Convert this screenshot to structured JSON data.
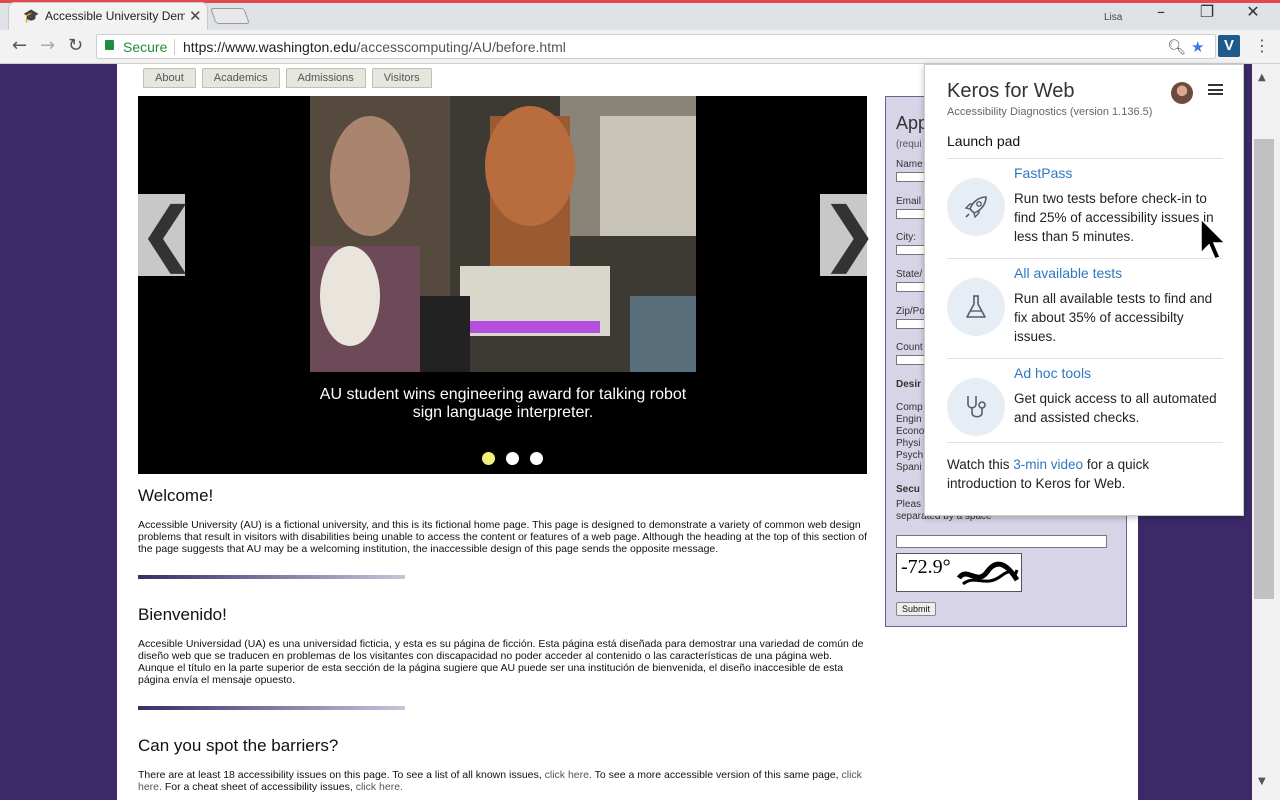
{
  "browser": {
    "tab_title": "Accessible University Dem",
    "tab_favicon": "graduation-cap-icon",
    "profile_name": "Lisa",
    "secure_label": "Secure",
    "url_prefix": "https://www.washington.edu",
    "url_path": "/accesscomputing/AU/before.html",
    "extension_label": "V"
  },
  "nav_tabs": [
    "About",
    "Academics",
    "Admissions",
    "Visitors"
  ],
  "carousel": {
    "caption": "AU student wins engineering award for talking robot sign language interpreter.",
    "slide_count": 3,
    "active_slide": 1,
    "prev_glyph": "❮",
    "next_glyph": "❯"
  },
  "sections": {
    "welcome_title": "Welcome!",
    "welcome_text": "Accessible University (AU) is a fictional university, and this is its fictional home page. This page is designed to demonstrate a variety of common web design problems that result in visitors with disabilities being unable to access the content or features of a web page. Although the heading at the top of this section of the page suggests that AU may be a welcoming institution, the inaccessible design of this page sends the opposite message.",
    "bienvenido_title": "Bienvenido!",
    "bienvenido_text": "Accesible Universidad (UA) es una universidad ficticia, y esta es su página de ficción. Esta página está diseñada para demostrar una variedad de común de diseño web que se traducen en problemas de los visitantes con discapacidad no poder acceder al contenido o las características de una página web. Aunque el título en la parte superior de esta sección de la página sugiere que AU puede ser una institución de bienvenida, el diseño inaccesible de esta página envía el mensaje opuesto.",
    "barriers_title": "Can you spot the barriers?",
    "barriers_text_1": "There are at least 18 accessibility issues on this page. To see a list of all known issues, ",
    "barriers_link_1": "click here.",
    "barriers_text_2": " To see a more accessible version of this same page, ",
    "barriers_link_2": "click here.",
    "barriers_text_3": " For a cheat sheet of accessibility issues, ",
    "barriers_link_3": "click here."
  },
  "form": {
    "title": "App",
    "required_note": "(requi",
    "labels": [
      "Name",
      "Email",
      "City:",
      "State/",
      "Zip/Po",
      "Count"
    ],
    "desired_label": "Desir",
    "majors": [
      "Comp",
      "Engin",
      "Econo",
      "Physi",
      "Psych",
      "Spani"
    ],
    "security_label": "Secu",
    "security_text_1": "Pleas",
    "security_text_2": "separated by a space",
    "captcha_text": "-72.9°",
    "captcha_word": "ably",
    "submit_label": "Submit"
  },
  "popup": {
    "title": "Keros for Web",
    "subtitle": "Accessibility Diagnostics (version 1.136.5)",
    "launch_pad": "Launch pad",
    "items": [
      {
        "name": "FastPass",
        "icon": "rocket-icon",
        "desc": "Run two tests before check-in to find 25% of accessibility issues in less than 5 minutes."
      },
      {
        "name": "All available tests",
        "icon": "flask-icon",
        "desc": "Run all available tests to find and fix about 35% of accessibilty issues."
      },
      {
        "name": "Ad hoc tools",
        "icon": "stethoscope-icon",
        "desc": "Get quick access to all automated and assisted checks."
      }
    ],
    "watch_prefix": "Watch this ",
    "watch_link": "3-min video",
    "watch_suffix": " for a quick introduction to Keros for Web."
  },
  "colors": {
    "page_background": "#3b2a67",
    "popup_link": "#2e78c0",
    "form_background": "#d6d4e6",
    "active_dot": "#f2f07a"
  }
}
